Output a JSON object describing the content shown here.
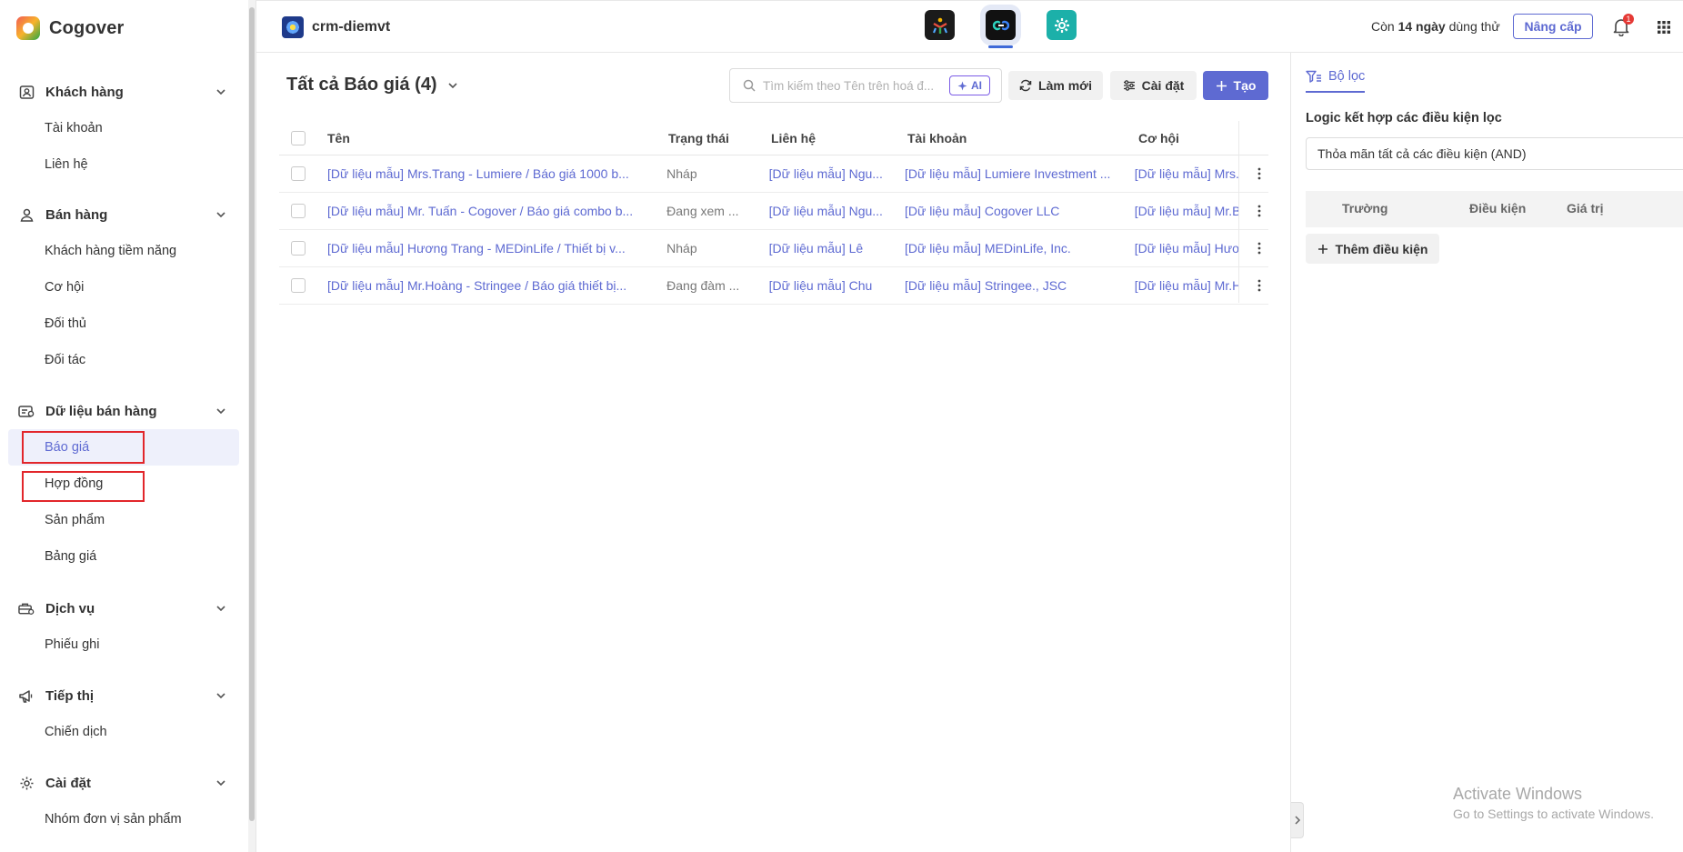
{
  "brand": {
    "name": "Cogover"
  },
  "sidebar": {
    "groups": [
      {
        "label": "Khách hàng",
        "items": [
          "Tài khoản",
          "Liên hệ"
        ]
      },
      {
        "label": "Bán hàng",
        "items": [
          "Khách hàng tiềm năng",
          "Cơ hội",
          "Đối thủ",
          "Đối tác"
        ]
      },
      {
        "label": "Dữ liệu bán hàng",
        "items": [
          "Báo giá",
          "Hợp đồng",
          "Sản phẩm",
          "Bảng giá"
        ]
      },
      {
        "label": "Dịch vụ",
        "items": [
          "Phiếu ghi"
        ]
      },
      {
        "label": "Tiếp thị",
        "items": [
          "Chiến dịch"
        ]
      },
      {
        "label": "Cài đặt",
        "items": [
          "Nhóm đơn vị sản phẩm"
        ]
      }
    ],
    "active_item": "Báo giá"
  },
  "topbar": {
    "workspace": "crm-diemvt",
    "trial_prefix": "Còn ",
    "trial_days": "14 ngày",
    "trial_suffix": " dùng thử",
    "upgrade_label": "Nâng cấp",
    "notification_count": "1"
  },
  "main": {
    "title": "Tất cả Báo giá (4)",
    "search_placeholder": "Tìm kiếm theo Tên trên hoá đ...",
    "ai_label": "AI",
    "refresh_label": "Làm mới",
    "settings_label": "Cài đặt",
    "create_label": "Tạo",
    "columns": [
      "Tên",
      "Trạng thái",
      "Liên hệ",
      "Tài khoản",
      "Cơ hội"
    ],
    "rows": [
      {
        "name": "[Dữ liệu mẫu] Mrs.Trang - Lumiere / Báo giá 1000 b...",
        "status": "Nháp",
        "contact": "[Dữ liệu mẫu] Ngu...",
        "account": "[Dữ liệu mẫu] Lumiere Investment ...",
        "opportunity": "[Dữ liệu mẫu] Mrs."
      },
      {
        "name": "[Dữ liệu mẫu] Mr. Tuấn - Cogover / Báo giá combo b...",
        "status": "Đang xem ...",
        "contact": "[Dữ liệu mẫu] Ngu...",
        "account": "[Dữ liệu mẫu] Cogover LLC",
        "opportunity": "[Dữ liệu mẫu] Mr.B"
      },
      {
        "name": "[Dữ liệu mẫu] Hương Trang - MEDinLife / Thiết bị v...",
        "status": "Nháp",
        "contact": "[Dữ liệu mẫu] Lê",
        "account": "[Dữ liệu mẫu] MEDinLife, Inc.",
        "opportunity": "[Dữ liệu mẫu] Hươi"
      },
      {
        "name": "[Dữ liệu mẫu] Mr.Hoàng - Stringee / Báo giá thiết bị...",
        "status": "Đang đàm ...",
        "contact": "[Dữ liệu mẫu] Chu",
        "account": "[Dữ liệu mẫu] Stringee., JSC",
        "opportunity": "[Dữ liệu mẫu] Mr.H"
      }
    ]
  },
  "filter_panel": {
    "tab_label": "Bộ lọc",
    "logic_label": "Logic kết hợp các điều kiện lọc",
    "logic_value": "Thỏa mãn tất cả các điều kiện (AND)",
    "columns": [
      "Trường",
      "Điều kiện",
      "Giá trị"
    ],
    "add_condition_label": "Thêm điều kiện"
  },
  "watermark": {
    "line1": "Activate Windows",
    "line2": "Go to Settings to activate Windows."
  },
  "colors": {
    "accent": "#5e6ad2",
    "highlight_box": "#e2262b"
  }
}
